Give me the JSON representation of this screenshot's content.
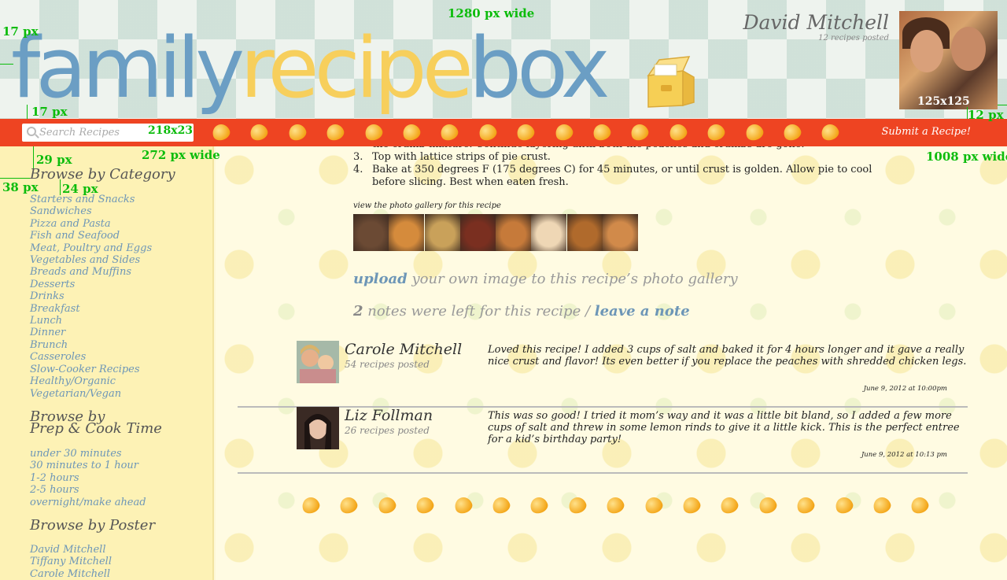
{
  "header": {
    "logo": {
      "part1": "family",
      "part2": "recipe",
      "part3": "box"
    },
    "user_name": "David Mitchell",
    "user_count": "12 recipes posted",
    "avatar_size": "125x125"
  },
  "annotations": {
    "page_width": "1280 px wide",
    "top_left": "17 px",
    "logo_bottom": "17 px",
    "right_margin": "12 px",
    "sidebar_top": "29 px",
    "sidebar_width": "272 px wide",
    "sidebar_left": "38 px",
    "sidebar_indent": "24 px",
    "main_width": "1008 px wide",
    "search_size": "218x23"
  },
  "navbar": {
    "search_placeholder": "Search Recipes",
    "submit_label": "Submit a Recipe!"
  },
  "sidebar": {
    "category_heading": "Browse by Category",
    "categories": [
      "Starters and Snacks",
      "Sandwiches",
      "Pizza and Pasta",
      "Fish and Seafood",
      "Meat, Poultry and Eggs",
      "Vegetables and Sides",
      "Breads and Muffins",
      "Desserts",
      "Drinks",
      "Breakfast",
      "Lunch",
      "Dinner",
      "Brunch",
      "Casseroles",
      "Slow-Cooker Recipes",
      "Healthy/Organic",
      "Vegetarian/Vegan"
    ],
    "time_heading_1": "Browse by",
    "time_heading_2": "Prep & Cook Time",
    "times": [
      "under 30 minutes",
      "30 minutes to 1 hour",
      "1-2 hours",
      "2-5 hours",
      "overnight/make ahead"
    ],
    "poster_heading": "Browse by Poster",
    "posters": [
      "David Mitchell",
      "Tiffany Mitchell",
      "Carole Mitchell"
    ]
  },
  "recipe": {
    "steps": [
      {
        "num": "",
        "text": "the crumb mixture.  Continue layering until both the peaches and crumbs are gone."
      },
      {
        "num": "3.",
        "text": "Top with lattice strips of pie crust."
      },
      {
        "num": "4.",
        "text": "Bake at 350 degrees F (175 degrees C) for 45 minutes, or until crust is golden.  Allow pie to cool before slicing.  Best when eaten fresh."
      }
    ],
    "gallery_label": "view the photo gallery for this recipe",
    "thumb_colors": [
      "#6b4a34",
      "#d58b3c",
      "#c9a15a",
      "#7a2f20",
      "#c67a3a",
      "#efd7b5",
      "#b06a2c",
      "#d18a4a"
    ],
    "upload_link": "upload",
    "upload_text": " your own image to this recipe’s photo gallery",
    "notes_count": "2",
    "notes_text": " notes were left for this recipe / ",
    "leave_note": "leave a note"
  },
  "notes": [
    {
      "name": "Carole Mitchell",
      "count": "54 recipes posted",
      "text": "Loved this recipe! I added 3 cups of salt and baked it for 4 hours longer and it gave a really nice crust and flavor! Its even better if you replace the peaches with shredded chicken legs.",
      "date": "June 9, 2012 at 10:00pm"
    },
    {
      "name": "Liz Follman",
      "count": "26 recipes posted",
      "text": "This was so good! I tried it mom’s way and it was a little bit bland, so I added a few more cups of salt and threw in some lemon rinds to give it a little kick.  This is the perfect entree for a kid’s birthday party!",
      "date": "June 9, 2012 at 10:13 pm"
    }
  ]
}
